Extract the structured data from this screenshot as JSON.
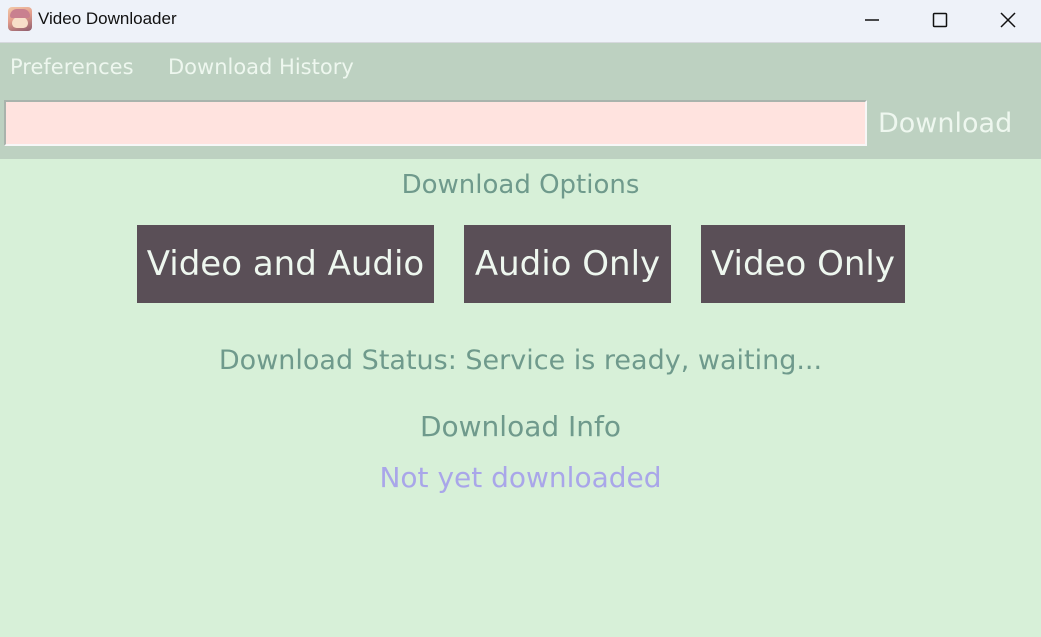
{
  "window": {
    "title": "Video Downloader",
    "icon": "anime-avatar-icon"
  },
  "menu": {
    "items": [
      {
        "label": "Preferences"
      },
      {
        "label": "Download History"
      }
    ]
  },
  "url_bar": {
    "value": "",
    "placeholder": "",
    "download_label": "Download"
  },
  "options": {
    "heading": "Download Options",
    "buttons": [
      {
        "label": "Video and Audio"
      },
      {
        "label": "Audio Only"
      },
      {
        "label": "Video Only"
      }
    ]
  },
  "status": {
    "text": "Download Status: Service is ready, waiting..."
  },
  "info": {
    "heading": "Download Info",
    "value": "Not yet downloaded"
  },
  "colors": {
    "background": "#d7f0d8",
    "toolbar": "#bdd1c1",
    "button": "#5a4f57",
    "heading_text": "#6f9a8c",
    "info_text": "#a9a6e9",
    "input_bg": "#ffe3df"
  }
}
